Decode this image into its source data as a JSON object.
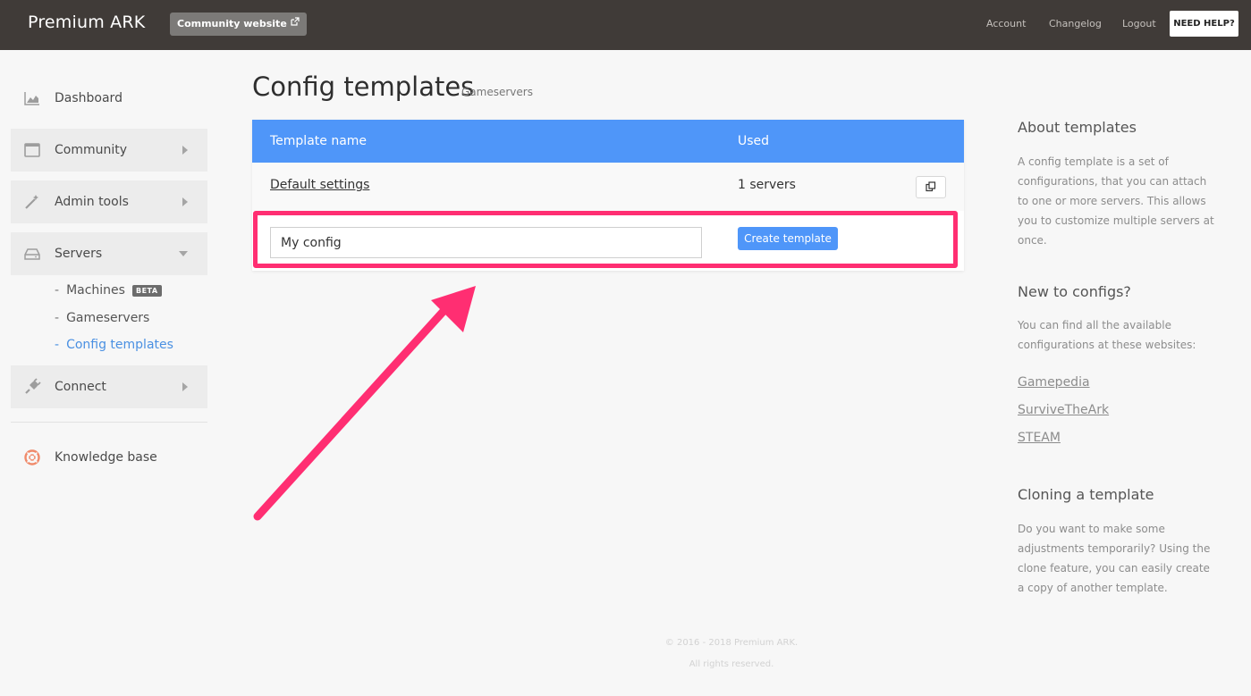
{
  "header": {
    "brand": "Premium ARK",
    "community_button": "Community website",
    "nav": [
      "Account",
      "Changelog",
      "Logout"
    ],
    "help_button": "NEED HELP?"
  },
  "sidebar": {
    "items": [
      {
        "label": "Dashboard",
        "icon": "area-chart-icon"
      },
      {
        "label": "Community",
        "icon": "window-icon"
      },
      {
        "label": "Admin tools",
        "icon": "magic-wand-icon"
      },
      {
        "label": "Servers",
        "icon": "hard-drive-icon"
      },
      {
        "label": "Connect",
        "icon": "plug-icon"
      },
      {
        "label": "Knowledge base",
        "icon": "life-ring-icon"
      }
    ],
    "server_subitems": [
      {
        "label": "Machines",
        "badge": "BETA"
      },
      {
        "label": "Gameservers"
      },
      {
        "label": "Config templates",
        "active": true
      }
    ]
  },
  "main": {
    "title": "Config templates",
    "subtitle": "Gameservers",
    "table": {
      "headers": [
        "Template name",
        "Used"
      ],
      "rows": [
        {
          "name": "Default settings",
          "used": "1 servers"
        }
      ]
    },
    "new_template": {
      "value": "My config",
      "button": "Create template"
    }
  },
  "info": {
    "about_title": "About templates",
    "about_text": "A config template is a set of configurations, that you can attach to one or more servers. This allows you to customize multiple servers at once.",
    "new_title": "New to configs?",
    "new_text": "You can find all the available configurations at these websites:",
    "links": [
      "Gamepedia",
      "SurviveTheArk",
      "STEAM"
    ],
    "clone_title": "Cloning a template",
    "clone_text": "Do you want to make some adjustments temporarily? Using the clone feature, you can easily create a copy of another template."
  },
  "footer": {
    "copyright": "© 2016 - 2018 Premium ARK.",
    "rights": "All rights reserved."
  },
  "colors": {
    "topbar": "#403b38",
    "accent": "#4f96f9",
    "highlight": "#ff2e72"
  }
}
